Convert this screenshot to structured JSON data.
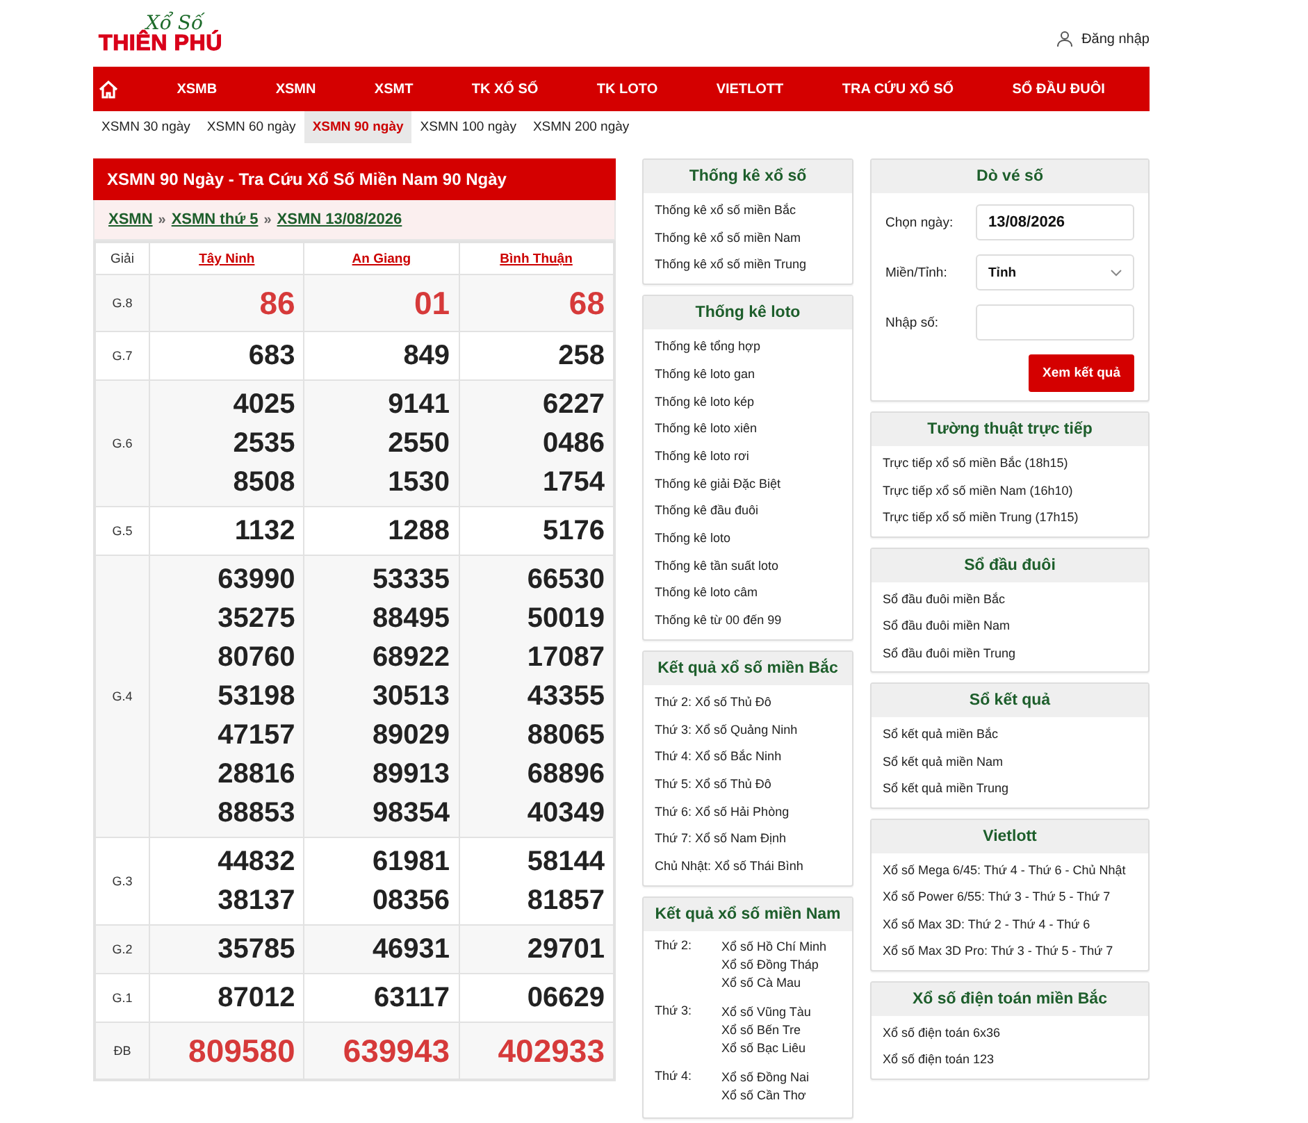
{
  "header": {
    "logo_top": "Xổ Số",
    "logo_bottom": "THIÊN PHÚ",
    "login": "Đăng nhập"
  },
  "nav": [
    "XSMB",
    "XSMN",
    "XSMT",
    "TK XỔ SỐ",
    "TK LOTO",
    "VIETLOTT",
    "TRA CỨU XỔ SỐ",
    "SỔ ĐẦU ĐUÔI"
  ],
  "subnav": [
    {
      "label": "XSMN 30 ngày",
      "selected": false
    },
    {
      "label": "XSMN 60 ngày",
      "selected": false
    },
    {
      "label": "XSMN 90 ngày",
      "selected": true
    },
    {
      "label": "XSMN 100 ngày",
      "selected": false
    },
    {
      "label": "XSMN 200 ngày",
      "selected": false
    }
  ],
  "results": {
    "title": "XSMN 90 Ngày - Tra Cứu Xổ Số Miền Nam 90 Ngày",
    "breadcrumb": [
      "XSMN",
      "XSMN thứ 5",
      "XSMN 13/08/2026"
    ],
    "separator": "»",
    "columns": [
      "Giải",
      "Tây Ninh",
      "An Giang",
      "Bình Thuận"
    ],
    "rows": [
      {
        "prize": "G.8",
        "kind": "accent",
        "values": [
          [
            "86"
          ],
          [
            "01"
          ],
          [
            "68"
          ]
        ]
      },
      {
        "prize": "G.7",
        "kind": "normal",
        "values": [
          [
            "683"
          ],
          [
            "849"
          ],
          [
            "258"
          ]
        ]
      },
      {
        "prize": "G.6",
        "kind": "normal",
        "values": [
          [
            "4025",
            "2535",
            "8508"
          ],
          [
            "9141",
            "2550",
            "1530"
          ],
          [
            "6227",
            "0486",
            "1754"
          ]
        ]
      },
      {
        "prize": "G.5",
        "kind": "normal",
        "values": [
          [
            "1132"
          ],
          [
            "1288"
          ],
          [
            "5176"
          ]
        ]
      },
      {
        "prize": "G.4",
        "kind": "normal",
        "values": [
          [
            "63990",
            "35275",
            "80760",
            "53198",
            "47157",
            "28816",
            "88853"
          ],
          [
            "53335",
            "88495",
            "68922",
            "30513",
            "89029",
            "89913",
            "98354"
          ],
          [
            "66530",
            "50019",
            "17087",
            "43355",
            "88065",
            "68896",
            "40349"
          ]
        ]
      },
      {
        "prize": "G.3",
        "kind": "normal",
        "values": [
          [
            "44832",
            "38137"
          ],
          [
            "61981",
            "08356"
          ],
          [
            "58144",
            "81857"
          ]
        ]
      },
      {
        "prize": "G.2",
        "kind": "normal",
        "values": [
          [
            "35785"
          ],
          [
            "46931"
          ],
          [
            "29701"
          ]
        ]
      },
      {
        "prize": "G.1",
        "kind": "normal",
        "values": [
          [
            "87012"
          ],
          [
            "63117"
          ],
          [
            "06629"
          ]
        ]
      },
      {
        "prize": "ĐB",
        "kind": "accent",
        "values": [
          [
            "809580"
          ],
          [
            "639943"
          ],
          [
            "402933"
          ]
        ]
      }
    ]
  },
  "middle": [
    {
      "kind": "list",
      "title": "Thống kê xổ số",
      "items": [
        "Thống kê xổ số miền Bắc",
        "Thống kê xổ số miền Nam",
        "Thống kê xổ số miền Trung"
      ]
    },
    {
      "kind": "list",
      "title": "Thống kê loto",
      "items": [
        "Thống kê tổng hợp",
        "Thống kê loto gan",
        "Thống kê loto kép",
        "Thống kê loto xiên",
        "Thống kê loto rơi",
        "Thống kê giải Đặc Biệt",
        "Thống kê đầu đuôi",
        "Thống kê loto",
        "Thống kê tần suất loto",
        "Thống kê loto câm",
        "Thống kê từ 00 đến 99"
      ]
    },
    {
      "kind": "list",
      "title": "Kết quả xổ số miền Bắc",
      "items": [
        "Thứ 2: Xổ số Thủ Đô",
        "Thứ 3: Xổ số Quảng Ninh",
        "Thứ 4: Xổ số Bắc Ninh",
        "Thứ 5: Xổ số Thủ Đô",
        "Thứ 6: Xổ số Hải Phòng",
        "Thứ 7: Xổ số Nam Định",
        "Chủ Nhật: Xổ số Thái Bình"
      ]
    },
    {
      "kind": "schedule",
      "title": "Kết quả xổ số miền Nam",
      "days": [
        {
          "day": "Thứ 2:",
          "items": [
            "Xổ số Hồ Chí Minh",
            "Xổ số Đồng Tháp",
            "Xổ số Cà Mau"
          ]
        },
        {
          "day": "Thứ 3:",
          "items": [
            "Xổ số Vũng Tàu",
            "Xổ số Bến Tre",
            "Xổ số Bạc Liêu"
          ]
        },
        {
          "day": "Thứ 4:",
          "items": [
            "Xổ số Đồng Nai",
            "Xổ số Cần Thơ"
          ]
        }
      ]
    }
  ],
  "lookup": {
    "title": "Dò vé số",
    "date_label": "Chọn ngày:",
    "date_value": "13/08/2026",
    "region_label": "Miền/Tỉnh:",
    "region_value": "Tỉnh",
    "number_label": "Nhập số:",
    "button": "Xem kết quả"
  },
  "right": [
    {
      "title": "Tường thuật trực tiếp",
      "items": [
        "Trực tiếp xổ số miền Bắc (18h15)",
        "Trực tiếp xổ số miền Nam (16h10)",
        "Trực tiếp xổ số miền Trung (17h15)"
      ]
    },
    {
      "title": "Sổ đầu đuôi",
      "items": [
        "Sổ đầu đuôi miền Bắc",
        "Sổ đầu đuôi miền Nam",
        "Sổ đầu đuôi miền Trung"
      ]
    },
    {
      "title": "Sổ kết quả",
      "items": [
        "Sổ kết quả miền Bắc",
        "Sổ kết quả miền Nam",
        "Sổ kết quả miền Trung"
      ]
    },
    {
      "title": "Vietlott",
      "items": [
        "Xổ số Mega 6/45: Thứ 4 - Thứ 6 - Chủ Nhật",
        "Xổ số Power 6/55: Thứ 3 - Thứ 5 - Thứ 7",
        "Xổ số Max 3D: Thứ 2 - Thứ 4 - Thứ 6",
        "Xổ số Max 3D Pro: Thứ 3 - Thứ 5 - Thứ 7"
      ]
    },
    {
      "title": "Xổ số điện toán miền Bắc",
      "items": [
        "Xổ số điện toán 6x36",
        "Xổ số điện toán 123"
      ]
    }
  ]
}
